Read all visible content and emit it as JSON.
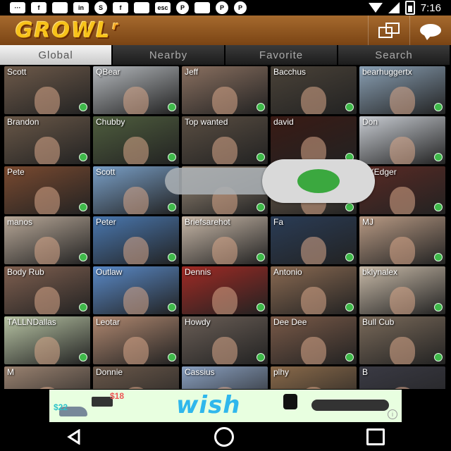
{
  "status_bar": {
    "time": "7:16",
    "notification_icons": [
      "messages-icon",
      "facebook-icon",
      "growl-wolf-icon",
      "linkedin-icon",
      "skype-icon",
      "facebook-icon",
      "growl-wolf-icon",
      "esc-icon",
      "pinterest-icon",
      "growl-wolf-icon",
      "pinterest-icon",
      "pinterest-icon"
    ],
    "notification_labels": [
      "···",
      "f",
      "",
      "in",
      "S",
      "f",
      "",
      "esc",
      "P",
      "",
      "P",
      "P"
    ]
  },
  "app_bar": {
    "logo_text": "GROWL",
    "logo_suffix": "r",
    "logo_color": "#f7c21a"
  },
  "tabs": [
    {
      "label": "Global",
      "active": true
    },
    {
      "label": "Nearby",
      "active": false
    },
    {
      "label": "Favorite",
      "active": false
    },
    {
      "label": "Search",
      "active": false
    }
  ],
  "grid": {
    "cells": [
      {
        "name": "Scott",
        "bg": "#6e5a4a",
        "online": true
      },
      {
        "name": "QBear",
        "bg": "#b4b8bc",
        "online": true
      },
      {
        "name": "Jeff",
        "bg": "#8a7060",
        "online": true
      },
      {
        "name": "Bacchus",
        "bg": "#4a4238",
        "online": true
      },
      {
        "name": "bearhuggertx",
        "bg": "#8aa0b4",
        "online": true
      },
      {
        "name": "Brandon",
        "bg": "#6a5848",
        "online": true
      },
      {
        "name": "Chubby",
        "bg": "#4f5e3e",
        "online": true
      },
      {
        "name": "Top wanted",
        "bg": "#5a4e42",
        "online": true
      },
      {
        "name": "david",
        "bg": "#3a1a14",
        "online": true
      },
      {
        "name": "Don",
        "bg": "#c8ccd2",
        "online": true
      },
      {
        "name": "Pete",
        "bg": "#7a4a30",
        "online": true
      },
      {
        "name": "Scott",
        "bg": "#7aa0c8",
        "online": true
      },
      {
        "name": "",
        "bg": "#9a8a78",
        "online": true
      },
      {
        "name": "",
        "bg": "#6a5a4a",
        "online": true
      },
      {
        "name": "NYEdger",
        "bg": "#5a2a24",
        "online": true
      },
      {
        "name": "manos",
        "bg": "#b8a898",
        "online": true
      },
      {
        "name": "Peter",
        "bg": "#4a78b0",
        "online": true
      },
      {
        "name": "Briefsarehot",
        "bg": "#c8b8a8",
        "online": true
      },
      {
        "name": "Fa",
        "bg": "#2a3c56",
        "online": true
      },
      {
        "name": "MJ",
        "bg": "#b89a84",
        "online": true
      },
      {
        "name": "Body Rub",
        "bg": "#806050",
        "online": true
      },
      {
        "name": "Outlaw",
        "bg": "#5a8ac8",
        "online": true
      },
      {
        "name": "Dennis",
        "bg": "#a02a24",
        "online": true
      },
      {
        "name": "Antonio",
        "bg": "#8a6a52",
        "online": true
      },
      {
        "name": "bklynalex",
        "bg": "#c8baa8",
        "online": true
      },
      {
        "name": "TALLNDallas",
        "bg": "#b8c4a4",
        "online": true
      },
      {
        "name": "Leotar",
        "bg": "#b08870",
        "online": true
      },
      {
        "name": "Howdy",
        "bg": "#6a5e56",
        "online": true
      },
      {
        "name": "Dee Dee",
        "bg": "#7a5a48",
        "online": true
      },
      {
        "name": "Bull Cub",
        "bg": "#7a6a5a",
        "online": true
      },
      {
        "name": "M",
        "bg": "#9a8270",
        "online": false
      },
      {
        "name": "Donnie",
        "bg": "#6a584a",
        "online": false
      },
      {
        "name": "Cassius",
        "bg": "#8aa0c0",
        "online": false
      },
      {
        "name": "plhy",
        "bg": "#8a6a4a",
        "online": false
      },
      {
        "name": "B",
        "bg": "#3a3a44",
        "online": false
      }
    ]
  },
  "toggle": {
    "state": "on",
    "accent_color": "#3ba83f"
  },
  "ad": {
    "brand": "wish",
    "price_left": "$22",
    "price_top": "$18",
    "info_glyph": "i"
  },
  "nav_bar": {
    "buttons": [
      "back-icon",
      "home-icon",
      "recents-icon"
    ]
  }
}
